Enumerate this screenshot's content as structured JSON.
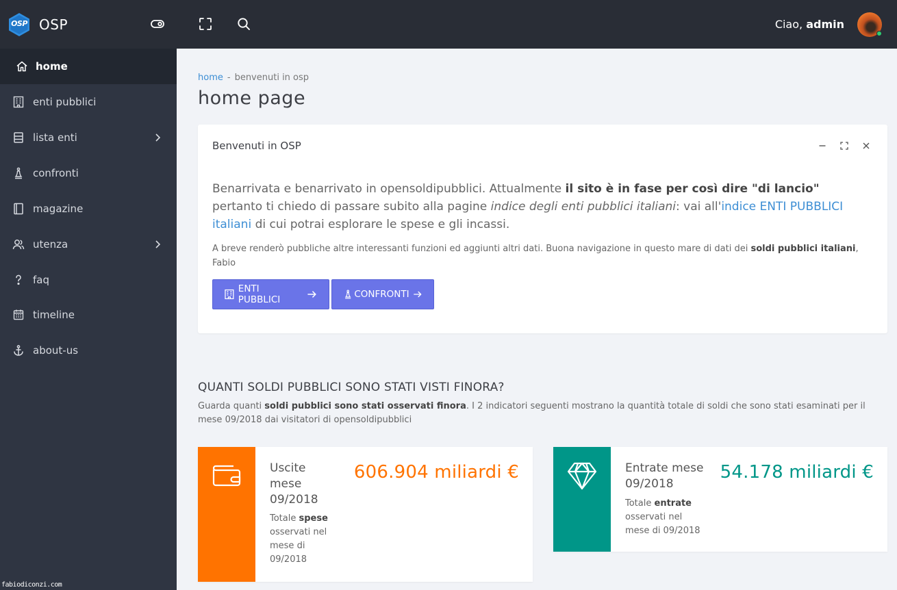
{
  "app": {
    "name": "OSP",
    "logo_text": "OSP"
  },
  "header": {
    "greeting": "Ciao,",
    "user": "admin"
  },
  "sidebar": {
    "items": [
      {
        "label": "home",
        "icon": "home-icon"
      },
      {
        "label": "enti pubblici",
        "icon": "building-icon"
      },
      {
        "label": "lista enti",
        "icon": "list-icon"
      },
      {
        "label": "confronti",
        "icon": "chess-icon"
      },
      {
        "label": "magazine",
        "icon": "book-icon"
      },
      {
        "label": "utenza",
        "icon": "users-icon"
      },
      {
        "label": "faq",
        "icon": "question-icon"
      },
      {
        "label": "timeline",
        "icon": "calendar-icon"
      },
      {
        "label": "about-us",
        "icon": "anchor-icon"
      }
    ],
    "watermark": "fabiodiconzi.com"
  },
  "breadcrumb": {
    "home": "home",
    "separator": "-",
    "current": "benvenuti in osp"
  },
  "page_title": "home page",
  "welcome_card": {
    "title": "Benvenuti in OSP",
    "lead_1": "Benarrivata e benarrivato in opensoldipubblici. Attualmente ",
    "lead_bold": "il sito è in fase per così dire \"di lancio\"",
    "lead_2": " pertanto ti chiedo di passare subito alla pagine ",
    "lead_italic": "indice degli enti pubblici italiani",
    "lead_3": ": vai all'",
    "lead_link": "indice ENTI PUBBLICI italiani",
    "lead_4": " di cui potrai esplorare le spese e gli incassi.",
    "small_1": "A breve renderò pubbliche altre interessanti funzioni ed aggiunti altri dati. Buona navigazione in questo mare di dati dei ",
    "small_bold": "soldi pubblici italiani",
    "small_2": ", Fabio",
    "btn_enti": "ENTI PUBBLICI",
    "btn_confronti": "CONFRONTI"
  },
  "stats_section": {
    "title": "QUANTI SOLDI PUBBLICI SONO STATI VISTI FINORA?",
    "desc_1": "Guarda quanti ",
    "desc_bold": "soldi pubblici sono stati osservati finora",
    "desc_2": ". I 2 indicatori seguenti mostrano la quantità totale di soldi che sono stati esaminati per il mese 09/2018 dai visitatori di opensoldipubblici"
  },
  "stats": [
    {
      "title_1": "Uscite",
      "title_2": "mese",
      "title_3": "09/2018",
      "value": "606.904 miliardi €",
      "desc_1": "Totale ",
      "desc_bold": "spese",
      "desc_2": "osservati nel",
      "desc_3": "mese di",
      "desc_4": "09/2018",
      "icon": "wallet-icon",
      "color": "#ff7300"
    },
    {
      "title_1": "Entrate mese",
      "title_2": "09/2018",
      "value": "54.178 miliardi €",
      "desc_1": "Totale ",
      "desc_bold": "entrate",
      "desc_2": "osservati nel",
      "desc_3": "mese di 09/2018",
      "icon": "diamond-icon",
      "color": "#009688"
    }
  ],
  "colors": {
    "sidebar": "#2f3542",
    "topbar": "#292d36",
    "accent_button": "#6a74e8",
    "link": "#3d8ed4",
    "orange": "#ff7300",
    "teal": "#009688"
  }
}
